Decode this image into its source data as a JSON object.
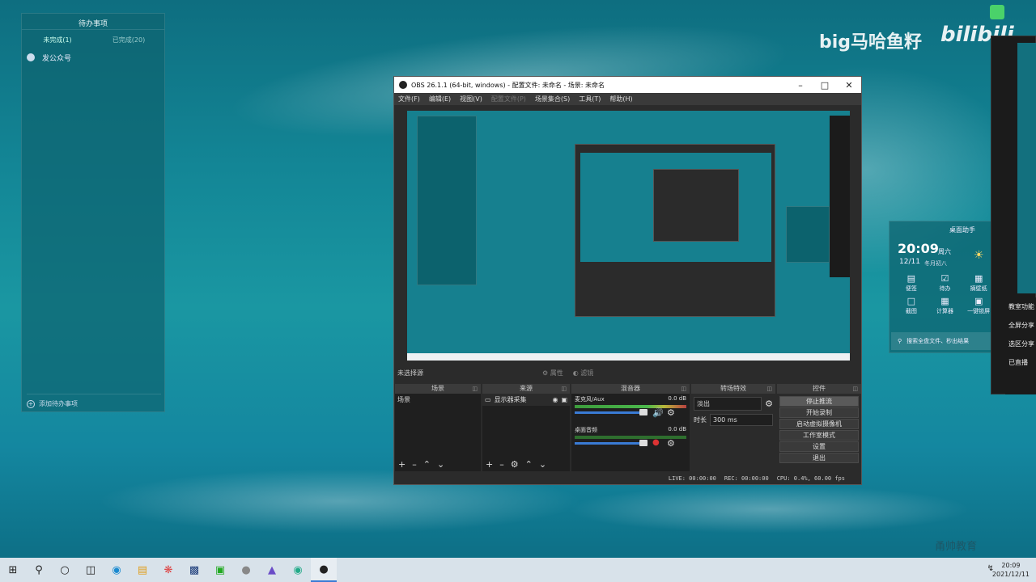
{
  "watermark": {
    "text": "big马哈鱼籽",
    "brand": "bilibili",
    "bottom_text": "甬帅教育"
  },
  "todo": {
    "title": "待办事项",
    "tabs": [
      "未完成(1)",
      "已完成(20)"
    ],
    "items": [
      "发公众号"
    ],
    "add_label": "添加待办事项"
  },
  "obs": {
    "title": "OBS 26.1.1 (64-bit, windows) - 配置文件: 未命名 - 场景: 未命名",
    "menu": [
      "文件(F)",
      "编辑(E)",
      "视图(V)",
      "配置文件(P)",
      "场景集合(S)",
      "工具(T)",
      "帮助(H)"
    ],
    "menu_disabled_index": 3,
    "no_source": "未选择源",
    "props_label": "属性",
    "filters_label": "滤镜",
    "docks": {
      "scenes": {
        "title": "场景",
        "items": [
          "场景"
        ]
      },
      "sources": {
        "title": "来源",
        "items": [
          "显示器采集"
        ]
      },
      "mixer": {
        "title": "混音器",
        "channels": [
          {
            "name": "麦克风/Aux",
            "db": "0.0 dB"
          },
          {
            "name": "桌面音频",
            "db": "0.0 dB"
          }
        ]
      },
      "transitions": {
        "title": "转场特效",
        "type": "淡出",
        "duration_label": "时长",
        "duration": "300 ms"
      },
      "controls": {
        "title": "控件",
        "buttons": [
          "停止推流",
          "开始录制",
          "启动虚拟摄像机",
          "工作室模式",
          "设置",
          "退出"
        ]
      }
    },
    "status": {
      "live": "LIVE: 00:00:00",
      "rec": "REC: 00:00:00",
      "cpu": "CPU: 0.4%, 60.00 fps"
    }
  },
  "assistant": {
    "title": "桌面助手",
    "time": "20:09",
    "weekday": "周六",
    "date": "12/11",
    "lunar": "冬月初八",
    "tools": [
      {
        "label": "便签",
        "icon": "note-icon"
      },
      {
        "label": "待办",
        "icon": "check-icon"
      },
      {
        "label": "摘壁纸",
        "icon": "image-icon"
      },
      {
        "label": "截图",
        "icon": "crop-icon"
      },
      {
        "label": "计算器",
        "icon": "calc-icon"
      },
      {
        "label": "一键锁屏",
        "icon": "lock-icon"
      }
    ],
    "search_placeholder": "搜索全盘文件、秒出结果"
  },
  "right_panel": {
    "items": [
      "教室功能",
      "全屏分享",
      "选区分享",
      "已直播"
    ]
  },
  "taskbar": {
    "time": "20:09",
    "date": "2021/12/11"
  }
}
